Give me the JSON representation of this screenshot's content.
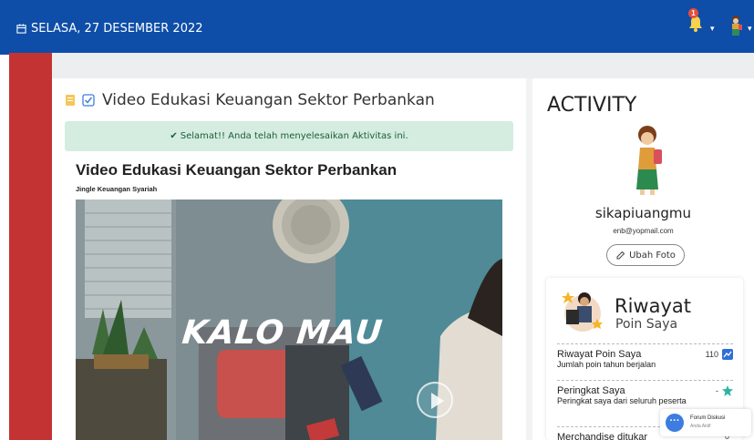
{
  "header": {
    "date": "SELASA, 27 DESEMBER 2022",
    "notification_count": "1"
  },
  "activity_card": {
    "heading": "Video Edukasi Keuangan Sektor Perbankan",
    "success_message": "Selamat!! Anda telah menyelesaikan Aktivitas ini.",
    "video_title": "Video Edukasi Keuangan Sektor Perbankan",
    "video_subtitle": "Jingle Keuangan Syariah",
    "video_overlay_text": "KALO MAU"
  },
  "profile": {
    "section_title": "ACTIVITY",
    "username": "sikapiuangmu",
    "email": "enb@yopmail.com",
    "change_photo_label": "Ubah Foto"
  },
  "points": {
    "title": "Riwayat",
    "subtitle": "Poin Saya",
    "rows": [
      {
        "label": "Riwayat Poin Saya",
        "sublabel": "Jumlah poin tahun berjalan",
        "value": "110"
      },
      {
        "label": "Peringkat Saya",
        "sublabel": "Peringkat saya dari seluruh peserta",
        "value": "-"
      },
      {
        "label": "Merchandise ditukar",
        "sublabel": "",
        "value": "0"
      }
    ]
  },
  "forum_widget": {
    "title": "Forum Diskusi",
    "status": "Anda Aktif"
  },
  "colors": {
    "topbar": "#0e4ea8",
    "sidebar_red": "#c43333",
    "success_bg": "#d4ede0"
  }
}
